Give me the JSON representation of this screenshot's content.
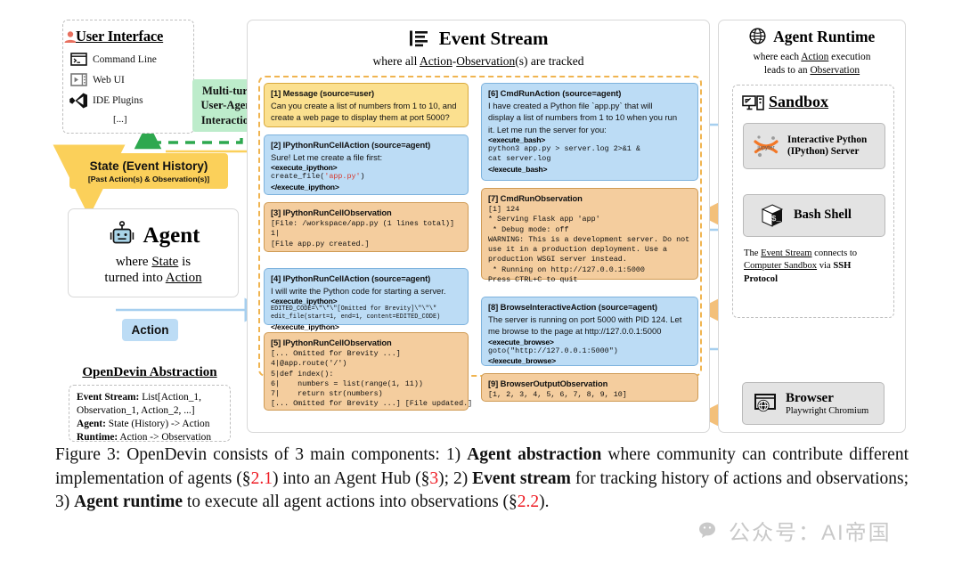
{
  "user_interface": {
    "title": "User Interface",
    "title_icon": "user-icon",
    "items": [
      {
        "label": "Command Line",
        "icon": "terminal-icon"
      },
      {
        "label": "Web UI",
        "icon": "browser-window-icon"
      },
      {
        "label": "IDE Plugins",
        "icon": "vscode-icon"
      },
      {
        "label": "[...]",
        "icon": "ellipsis"
      }
    ],
    "multi_turn": {
      "line1": "Multi-turn",
      "line2": "User-Agent",
      "line3": "Interaction",
      "color": "#bdeccb"
    }
  },
  "state": {
    "title": "State (Event History)",
    "subtitle": "[Past Action(s) & Observation(s)]",
    "color": "#fbd05a"
  },
  "agent": {
    "title": "Agent",
    "icon": "robot-icon",
    "sub_pre": "where ",
    "sub_u1": "State",
    "sub_mid": " is",
    "sub_line2_pre": "turned into ",
    "sub_u2": "Action"
  },
  "action_chip": {
    "label": "Action",
    "color": "#bcdcf5"
  },
  "abstraction": {
    "title": "OpenDevin Abstraction",
    "lines": [
      {
        "bold": "Event Stream:",
        "rest": " List[Action_1,"
      },
      {
        "bold": "",
        "rest": "Observation_1, Action_2, ...]"
      },
      {
        "bold": "Agent:",
        "rest": " State (History) -> Action"
      },
      {
        "bold": "Runtime:",
        "rest": " Action -> Observation"
      }
    ]
  },
  "event_stream": {
    "title": "Event Stream",
    "icon": "list-icon",
    "subtitle_pre": "where all ",
    "subtitle_u1": "Action",
    "subtitle_dash": "-",
    "subtitle_u2": "Observation",
    "subtitle_post": "(s) are tracked",
    "events": [
      {
        "id": "[1]",
        "header": "[1] Message (source=user)",
        "kind": "yellow",
        "body_text": "Can you create a list of numbers from 1 to 10, and\ncreate a web page to display them at port 5000?"
      },
      {
        "id": "[2]",
        "header": "[2] IPythonRunCellAction (source=agent)",
        "kind": "blue",
        "body_text": "Sure! Let me create a file first:",
        "tag_open": "<execute_ipython>",
        "code_pre": "create_file(",
        "code_str": "'app.py'",
        "code_post": ")",
        "tag_close": "</execute_ipython>"
      },
      {
        "id": "[3]",
        "header": "[3] IPythonRunCellObservation",
        "kind": "tan",
        "mono": "[File: /workspace/app.py (1 lines total)]\n1|\n[File app.py created.]"
      },
      {
        "id": "[4]",
        "header": "[4] IPythonRunCellAction (source=agent)",
        "kind": "blue",
        "body_text": "I will write the Python code for starting a server.",
        "tag_open": "<execute_ipython>",
        "mono_small": "EDITED_CODE=\\\"\\\"\\\"[Omitted for Brevity]\\\"\\\"\\\"\nedit_file(start=1, end=1, content=EDITED_CODE)",
        "tag_close": "</execute_ipython>"
      },
      {
        "id": "[5]",
        "header": "[5] IPythonRunCellObservation",
        "kind": "tan",
        "mono": "[... Omitted for Brevity ...]\n4|@app.route('/')\n5|def index():\n6|    numbers = list(range(1, 11))\n7|    return str(numbers)\n[... Omitted for Brevity ...] [File updated.]"
      },
      {
        "id": "[6]",
        "header": "[6] CmdRunAction (source=agent)",
        "kind": "blue",
        "body_text": "I have created a Python file `app.py` that will\ndisplay a list of numbers from 1 to 10 when you run\nit. Let me run the server for you:",
        "tag_open": "<execute_bash>",
        "mono": "python3 app.py > server.log 2>&1 &\ncat server.log",
        "tag_close": "</execute_bash>"
      },
      {
        "id": "[7]",
        "header": "[7] CmdRunObservation",
        "kind": "tan",
        "mono": "[1] 124\n* Serving Flask app 'app'\n * Debug mode: off\nWARNING: This is a development server. Do not\nuse it in a production deployment. Use a\nproduction WSGI server instead.\n * Running on http://127.0.0.1:5000\nPress CTRL+C to quit"
      },
      {
        "id": "[8]",
        "header": "[8] BrowseInteractiveAction (source=agent)",
        "kind": "blue",
        "body_text": "The server is running on port 5000 with PID 124. Let\nme browse to the page at http://127.0.0.1:5000",
        "tag_open": "<execute_browse>",
        "code_pre": "goto(",
        "code_str": "\"http://127.0.0.1:5000\"",
        "code_post": ")",
        "tag_close": "</execute_browse>"
      },
      {
        "id": "[9]",
        "header": "[9] BrowserOutputObservation",
        "kind": "tan",
        "mono": "[1, 2, 3, 4, 5, 6, 7, 8, 9, 10]"
      }
    ]
  },
  "runtime": {
    "title": "Agent Runtime",
    "icon": "globe-icon",
    "sub_pre": "where each ",
    "sub_u1": "Action",
    "sub_post": " execution",
    "sub_line2_pre": "leads to an ",
    "sub_u2": "Observation",
    "sandbox": {
      "title": "Sandbox",
      "icon": "computer-icon"
    },
    "cards": [
      {
        "label_line1": "Interactive Python",
        "label_line2": "(IPython) Server",
        "icon": "jupyter-icon"
      },
      {
        "label_line1": "Bash Shell",
        "label_line2": "",
        "icon": "shell-icon"
      },
      {
        "label_line1": "Browser",
        "label_line2": "Playwright Chromium",
        "icon": "browser-globe-icon"
      }
    ],
    "note": {
      "pre": "The ",
      "u1": "Event Stream",
      "mid": " connects to",
      "line2_u": "Computer Sandbox",
      "line2_mid": " via ",
      "line2_b": "SSH Protocol"
    }
  },
  "caption": {
    "p1": "Figure 3: OpenDevin consists of 3 main components: 1) ",
    "b1": "Agent abstraction",
    "p2": " where community can contribute different implementation of agents (§",
    "r1": "2.1",
    "p3": ") into an Agent Hub (§",
    "r2": "3",
    "p4": "); 2) ",
    "b2": "Event stream",
    "p5": " for tracking history of actions and observations; 3) ",
    "b3": "Agent runtime",
    "p6": " to execute all agent actions into observations (§",
    "r3": "2.2",
    "p7": ")."
  },
  "watermark": {
    "text": "公众号：AI帝国"
  }
}
